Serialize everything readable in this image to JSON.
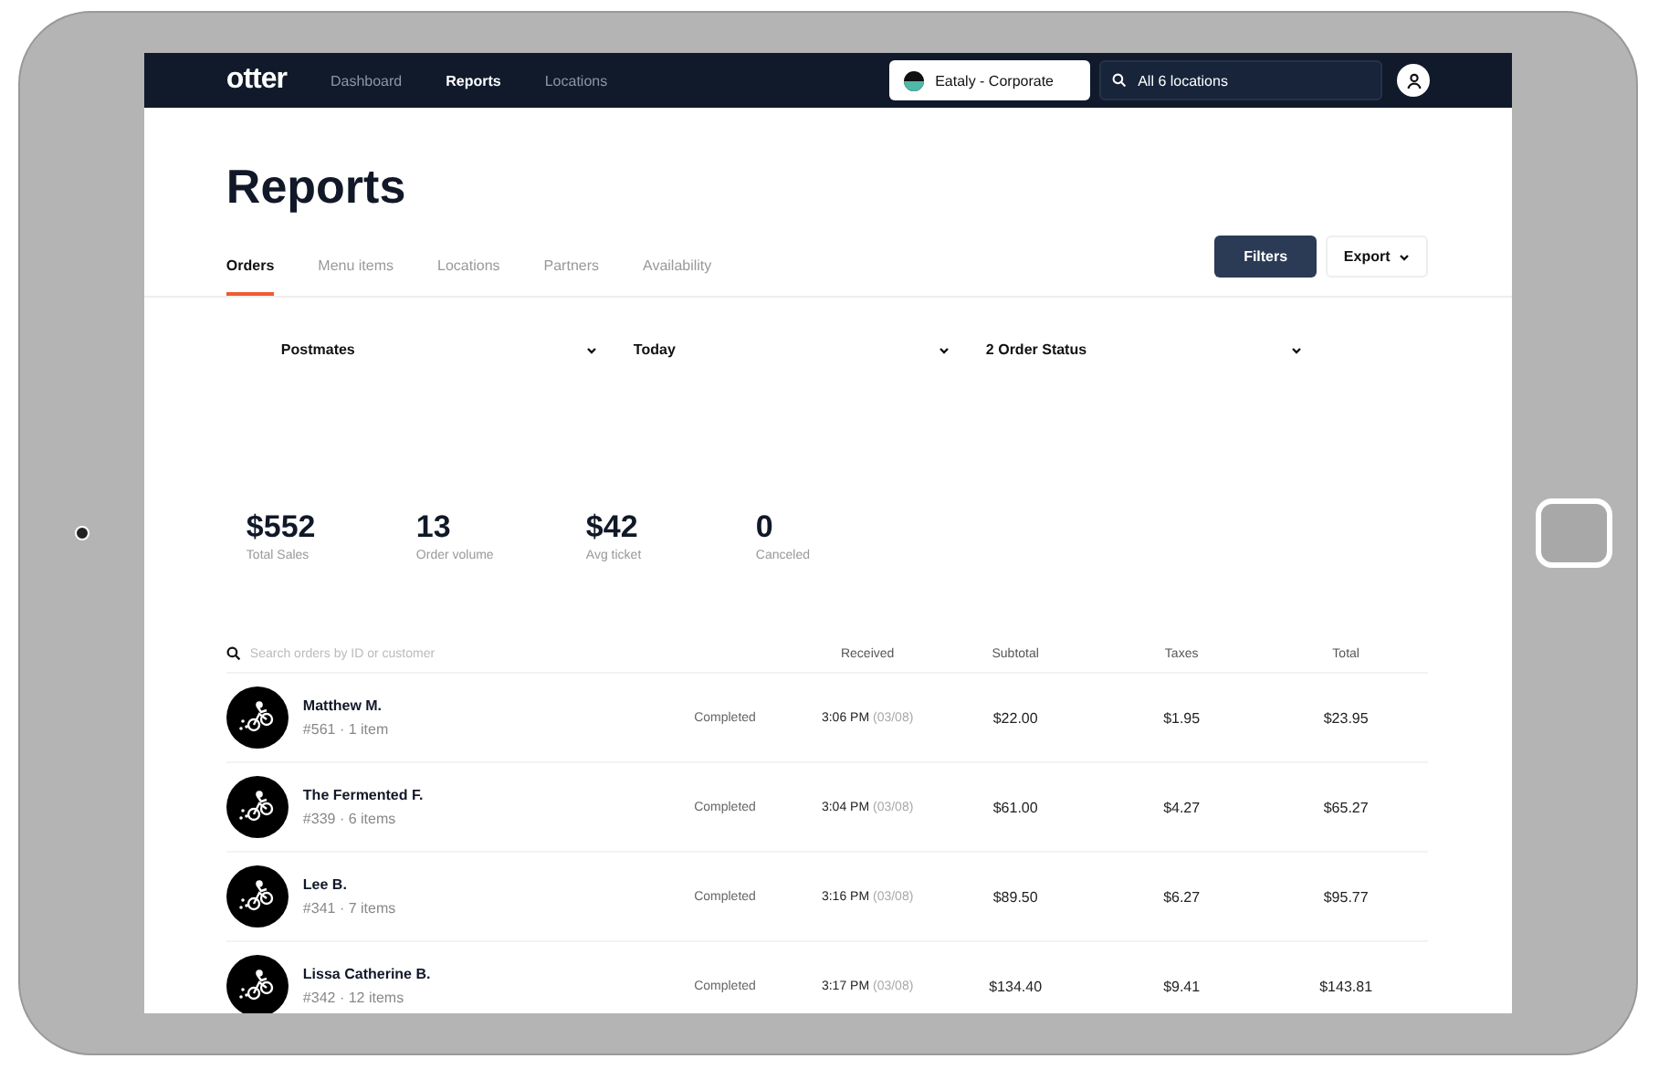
{
  "nav": {
    "logo": "otter",
    "links": [
      {
        "label": "Dashboard",
        "selected": false
      },
      {
        "label": "Reports",
        "selected": true
      },
      {
        "label": "Locations",
        "selected": false
      }
    ],
    "brand": "Eataly - Corporate",
    "search": {
      "value": "All 6 locations"
    }
  },
  "page": {
    "title": "Reports"
  },
  "tabs": [
    {
      "label": "Orders",
      "selected": true
    },
    {
      "label": "Menu items",
      "selected": false
    },
    {
      "label": "Locations",
      "selected": false
    },
    {
      "label": "Partners",
      "selected": false
    },
    {
      "label": "Availability",
      "selected": false
    }
  ],
  "actions": {
    "filters": "Filters",
    "export": "Export"
  },
  "filters": [
    {
      "value": "Postmates"
    },
    {
      "value": "Today"
    },
    {
      "value": "2 Order Status"
    }
  ],
  "stats": [
    {
      "value": "$552",
      "label": "Total Sales"
    },
    {
      "value": "13",
      "label": "Order volume"
    },
    {
      "value": "$42",
      "label": "Avg ticket"
    },
    {
      "value": "0",
      "label": "Canceled"
    }
  ],
  "table": {
    "search": {
      "placeholder": "Search orders by ID or customer"
    },
    "columns": [
      "Received",
      "Subtotal",
      "Taxes",
      "Total"
    ],
    "rows": [
      {
        "name": "Matthew M.",
        "detail": "#561 · 1 item",
        "status": "Completed",
        "time": "3:06 PM",
        "date": "(03/08)",
        "subtotal": "$22.00",
        "taxes": "$1.95",
        "total": "$23.95"
      },
      {
        "name": "The Fermented F.",
        "detail": "#339 · 6 items",
        "status": "Completed",
        "time": "3:04 PM",
        "date": "(03/08)",
        "subtotal": "$61.00",
        "taxes": "$4.27",
        "total": "$65.27"
      },
      {
        "name": "Lee B.",
        "detail": "#341 · 7 items",
        "status": "Completed",
        "time": "3:16 PM",
        "date": "(03/08)",
        "subtotal": "$89.50",
        "taxes": "$6.27",
        "total": "$95.77"
      },
      {
        "name": "Lissa Catherine B.",
        "detail": "#342 · 12 items",
        "status": "Completed",
        "time": "3:17 PM",
        "date": "(03/08)",
        "subtotal": "$134.40",
        "taxes": "$9.41",
        "total": "$143.81"
      }
    ]
  }
}
